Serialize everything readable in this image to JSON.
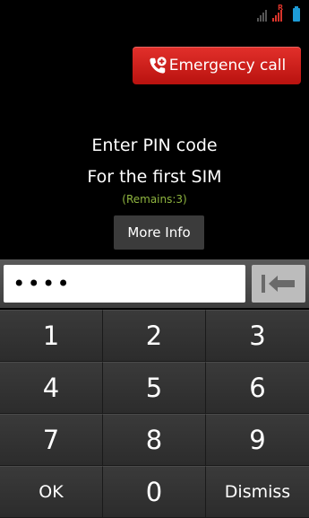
{
  "status_bar": {
    "signal_icon": "signal-bars-icon",
    "roaming_indicator": "R",
    "battery_icon": "battery-icon",
    "battery_color": "#1d9bd6"
  },
  "emergency": {
    "label": "Emergency call",
    "icon": "phone-plus-icon",
    "color": "#d01f1b"
  },
  "prompt": {
    "title": "Enter PIN code",
    "subtitle": "For the first SIM",
    "remains": "(Remains:3)",
    "remains_color": "#8fb53f",
    "more_info_label": "More Info"
  },
  "pin": {
    "masked_value": "••••",
    "backspace_icon": "backspace-icon"
  },
  "keypad": {
    "keys": [
      {
        "label": "1"
      },
      {
        "label": "2"
      },
      {
        "label": "3"
      },
      {
        "label": "4"
      },
      {
        "label": "5"
      },
      {
        "label": "6"
      },
      {
        "label": "7"
      },
      {
        "label": "8"
      },
      {
        "label": "9"
      },
      {
        "label": "OK"
      },
      {
        "label": "0"
      },
      {
        "label": "Dismiss"
      }
    ]
  }
}
